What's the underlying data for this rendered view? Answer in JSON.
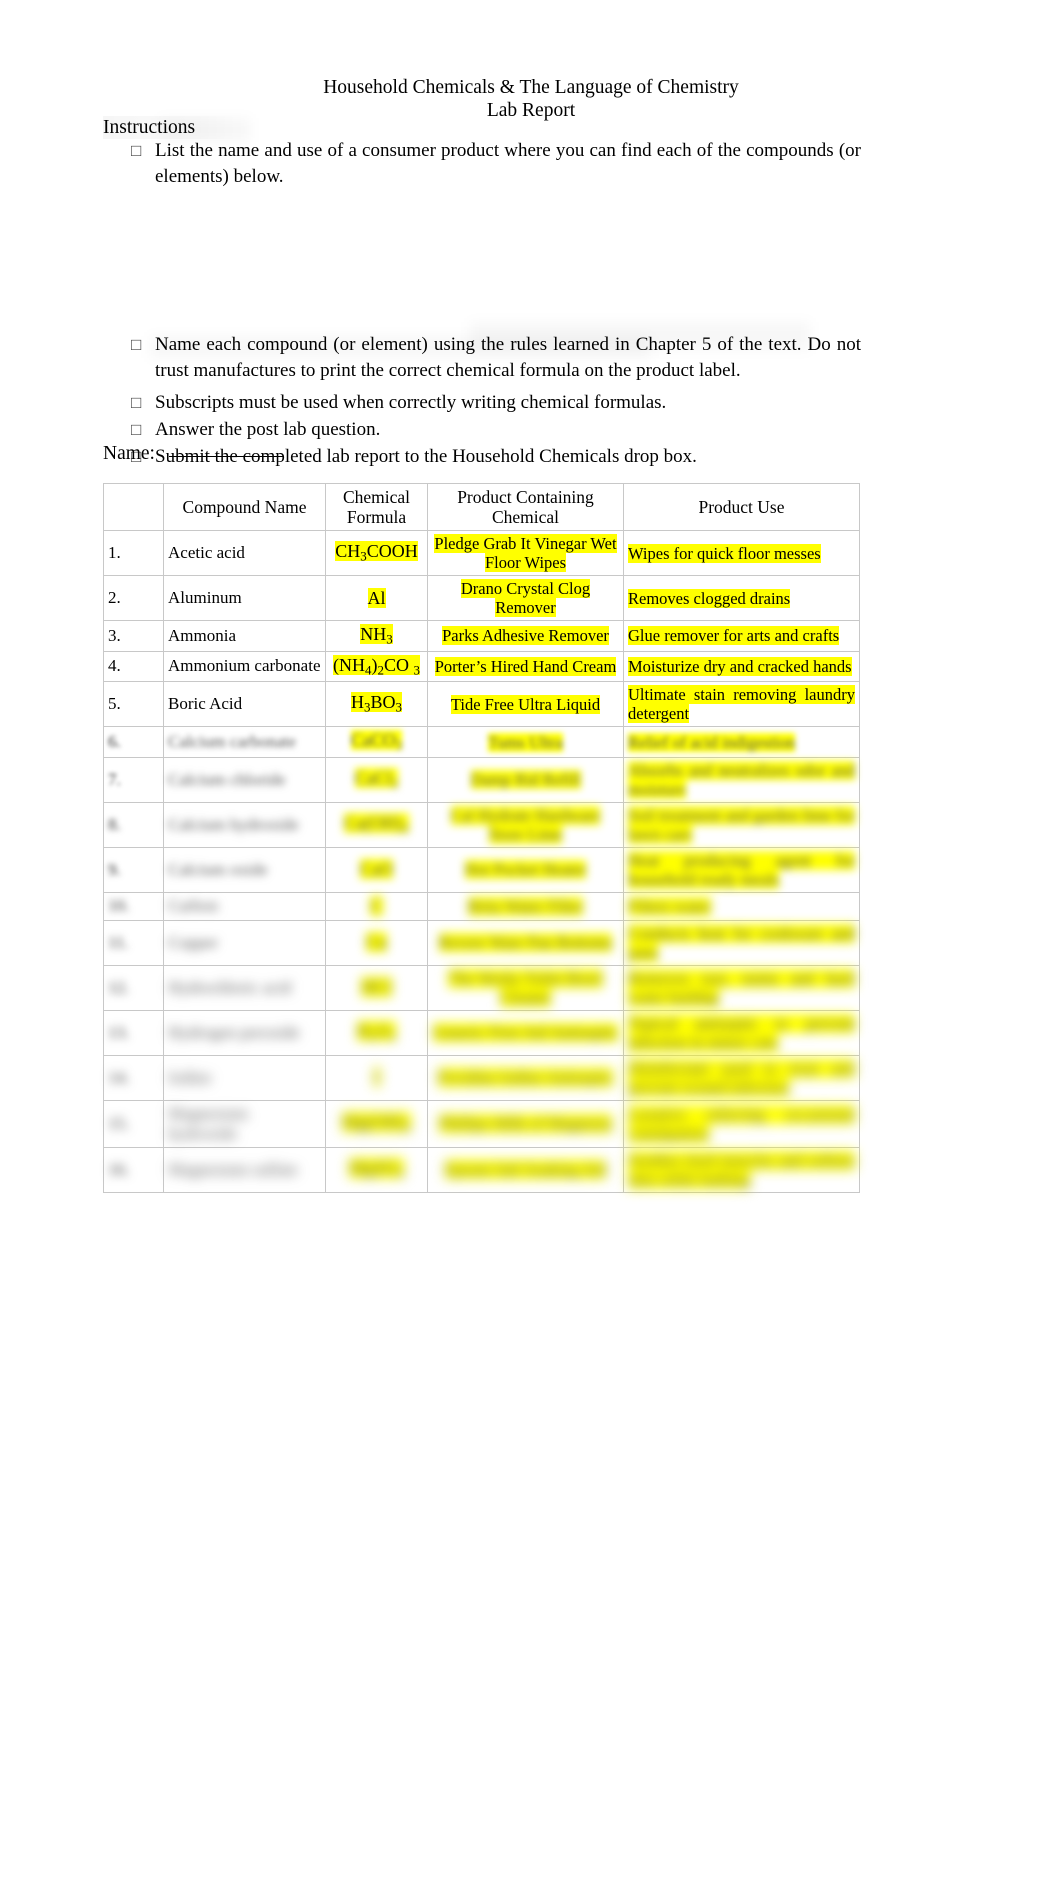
{
  "document": {
    "title_line1": "Household Chemicals & The Language of Chemistry",
    "title_line2": "Lab Report",
    "instructions_heading": "Instructions",
    "bullet_marker": "□"
  },
  "instructions": [
    "List the name and use of a consumer product where you can find each of the compounds (or elements) below.",
    "Name each compound (or element)      using the rules learned in Chapter 5          of the text.   Do not trust manufactures to print the correct chemical formula on the product label.",
    "Subscripts must be used when correctly writing chemical formulas.",
    "Answer the post lab question.",
    "Submit the completed lab report to the Household Chemicals drop box."
  ],
  "name_field": {
    "label": "Name:",
    "value": ""
  },
  "table": {
    "headers": {
      "number": "",
      "compound_name": "Compound Name",
      "chemical_formula_line1": "Chemical",
      "chemical_formula_line2": "Formula",
      "product_containing_line1": "Product Containing",
      "product_containing_line2": "Chemical",
      "product_use": "Product Use"
    },
    "rows": [
      {
        "num": "1.",
        "compound": "Acetic acid",
        "formula_html": "CH<sub>3</sub>COOH",
        "product": "Pledge Grab It Vinegar Wet Floor Wipes",
        "use": "Wipes for quick floor messes",
        "blur": 0,
        "highlight": true
      },
      {
        "num": "2.",
        "compound": "Aluminum",
        "formula_html": "Al",
        "product": "Drano Crystal Clog Remover",
        "use": "Removes clogged drains",
        "blur": 0,
        "highlight": true
      },
      {
        "num": "3.",
        "compound": "Ammonia",
        "formula_html": "NH<sub>3</sub>",
        "product": "Parks Adhesive Remover",
        "use": "Glue remover for arts and crafts",
        "blur": 0,
        "highlight": true
      },
      {
        "num": "4.",
        "compound": "Ammonium carbonate",
        "formula_html": "(NH<sub>4</sub>)<sub>2</sub>CO <sub>3</sub>",
        "product": "Porter’s Hired Hand Cream",
        "use": "Moisturize dry and cracked hands",
        "blur": 0,
        "highlight": true
      },
      {
        "num": "5.",
        "compound": "Boric Acid",
        "formula_html": "H<sub>3</sub>BO<sub>3</sub>",
        "product": "Tide Free Ultra Liquid",
        "use": "Ultimate stain removing laundry detergent",
        "blur": 0,
        "highlight": true
      },
      {
        "num": "6.",
        "compound": "Calcium carbonate",
        "formula_html": "CaCO<sub>3</sub>",
        "product": "Tums Ultra",
        "use": "Relief of acid indigestion",
        "blur": 2,
        "highlight": true
      },
      {
        "num": "7.",
        "compound": "Calcium chloride",
        "formula_html": "CaCl<sub>2</sub>",
        "product": "Damp Rid Refill",
        "use": "Absorbs and neutralizes odor and moisture",
        "blur": 3,
        "highlight": true
      },
      {
        "num": "8.",
        "compound": "Calcium hydroxide",
        "formula_html": "Ca(OH)<sub>2</sub>",
        "product": "Cal Hydrate Hardware Store Lime",
        "use": "Soil treatment and garden lime for lawn care",
        "blur": 4,
        "highlight": true
      },
      {
        "num": "9.",
        "compound": "Calcium oxide",
        "formula_html": "CaO",
        "product": "Hot Pocket Heater",
        "use": "Heat producing agent for household ready meals",
        "blur": 4,
        "highlight": true
      },
      {
        "num": "10.",
        "compound": "Carbon",
        "formula_html": "C",
        "product": "Brita Water Filter",
        "use": "Filters water",
        "blur": 5,
        "highlight": true
      },
      {
        "num": "11.",
        "compound": "Copper",
        "formula_html": "Cu",
        "product": "Revere Ware Pan Bottoms",
        "use": "Conducts heat for cookware and pans",
        "blur": 5,
        "highlight": true
      },
      {
        "num": "12.",
        "compound": "Hydrochloric acid",
        "formula_html": "HCl",
        "product": "The Works Toilet Bowl Cleaner",
        "use": "Removes rust, stains and hard water buildup",
        "blur": 6,
        "highlight": true
      },
      {
        "num": "13.",
        "compound": "Hydrogen peroxide",
        "formula_html": "H<sub>2</sub>O<sub>2</sub>",
        "product": "Generic First Aid Antiseptic",
        "use": "Topical antiseptic to prevent infection in minor cuts",
        "blur": 6,
        "highlight": true
      },
      {
        "num": "14.",
        "compound": "Iodine",
        "formula_html": "I",
        "product": "Povidine Iodine Antiseptic",
        "use": "Disinfectant used to treat and prevent wound infection",
        "blur": 7,
        "highlight": true
      },
      {
        "num": "15.",
        "compound": "Magnesium hydroxide",
        "formula_html": "Mg(OH)<sub>2</sub>",
        "product": "Phillips Milk of Magnesia",
        "use": "Laxative relieving occasional constipation",
        "blur": 7,
        "highlight": true
      },
      {
        "num": "16.",
        "compound": "Magnesium sulfate",
        "formula_html": "MgSO<sub>4</sub>",
        "product": "Epsom Salt Soaking Aid",
        "use": "Soothes tired muscles and softens skin while bathing",
        "blur": 7,
        "highlight": true
      }
    ]
  },
  "colors": {
    "highlight": "#ffff00",
    "text": "#000000",
    "border": "#c8c8c8"
  }
}
